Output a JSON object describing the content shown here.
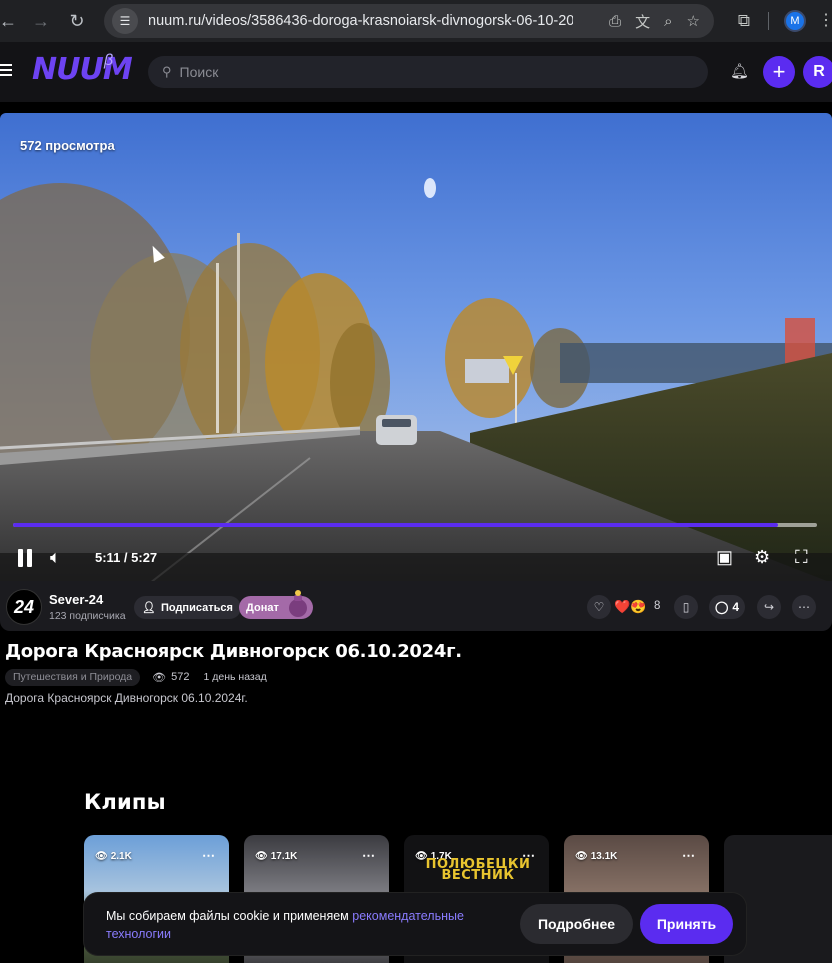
{
  "browser": {
    "url": "nuum.ru/videos/3586436-doroga-krasnoiarsk-divnogorsk-06-10-20...",
    "profile_initial": "M"
  },
  "header": {
    "logo": "NUUM",
    "logo_badge": "β",
    "search_placeholder": "Поиск",
    "user_initial": "R",
    "plus_label": "+"
  },
  "player": {
    "views_overlay": "572 просмотра",
    "time": "5:11 / 5:27",
    "progress_fraction": 0.951,
    "accent_color": "#5b2cf0"
  },
  "channel": {
    "avatar_text": "24",
    "name": "Sever-24",
    "subscribers": "123 подписчика",
    "subscribe_label": "Подписаться",
    "donate_label": "Донат"
  },
  "actions": {
    "reactions": "❤️😍",
    "reaction_count": "8",
    "comments_count": "4"
  },
  "video": {
    "title": "Дорога Красноярск Дивногорск 06.10.2024г.",
    "category": "Путешествия и Природа",
    "views": "572",
    "date": "1 день назад",
    "description": "Дорога Красноярск Дивногорск 06.10.2024г."
  },
  "clips": {
    "heading": "Клипы",
    "items": [
      {
        "views": "2.1K",
        "overlay_text": ""
      },
      {
        "views": "17.1K",
        "overlay_text": ""
      },
      {
        "views": "1.7K",
        "overlay_text": "ПОЛЮБЕЦКИ ВЕСТНИК"
      },
      {
        "views": "13.1K",
        "overlay_text": ""
      }
    ]
  },
  "cookie": {
    "text": "Мы собираем файлы cookie и применяем",
    "link_text": "рекомендательные технологии",
    "more_label": "Подробнее",
    "accept_label": "Принять"
  }
}
